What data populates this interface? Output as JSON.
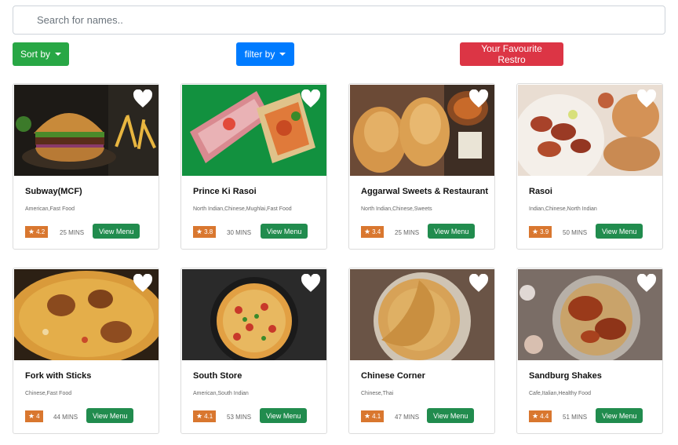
{
  "search": {
    "placeholder": "Search for names.."
  },
  "toolbar": {
    "sort_label": "Sort by",
    "filter_label": "filter by",
    "favourite_label": "Your Favourite Restro"
  },
  "restaurants": [
    {
      "name": "Subway(MCF)",
      "cuisine": "American,Fast Food",
      "rating": "4.2",
      "time": "25 MINS",
      "view_label": "View Menu"
    },
    {
      "name": "Prince Ki Rasoi",
      "cuisine": "North Indian,Chinese,Mughlai,Fast Food",
      "rating": "3.8",
      "time": "30 MINS",
      "view_label": "View Menu"
    },
    {
      "name": "Aggarwal Sweets & Restaurant",
      "cuisine": "North Indian,Chinese,Sweets",
      "rating": "3.4",
      "time": "25 MINS",
      "view_label": "View Menu"
    },
    {
      "name": "Rasoi",
      "cuisine": "Indian,Chinese,North Indian",
      "rating": "3.9",
      "time": "50 MINS",
      "view_label": "View Menu"
    },
    {
      "name": "Fork with Sticks",
      "cuisine": "Chinese,Fast Food",
      "rating": "4",
      "time": "44 MINS",
      "view_label": "View Menu"
    },
    {
      "name": "South Store",
      "cuisine": "American,South Indian",
      "rating": "4.1",
      "time": "53 MINS",
      "view_label": "View Menu"
    },
    {
      "name": "Chinese Corner",
      "cuisine": "Chinese,Thai",
      "rating": "4.1",
      "time": "47 MINS",
      "view_label": "View Menu"
    },
    {
      "name": "Sandburg Shakes",
      "cuisine": "Cafe,Italian,Healthy Food",
      "rating": "4.4",
      "time": "51 MINS",
      "view_label": "View Menu"
    }
  ],
  "colors": {
    "sort": "#28a745",
    "filter": "#007bff",
    "favourite": "#dc3545",
    "rating_badge": "#d9772f",
    "view_menu": "#218c4e"
  },
  "icons": {
    "favourite": "heart-icon",
    "rating": "star-icon",
    "dropdown": "caret-down-icon"
  }
}
